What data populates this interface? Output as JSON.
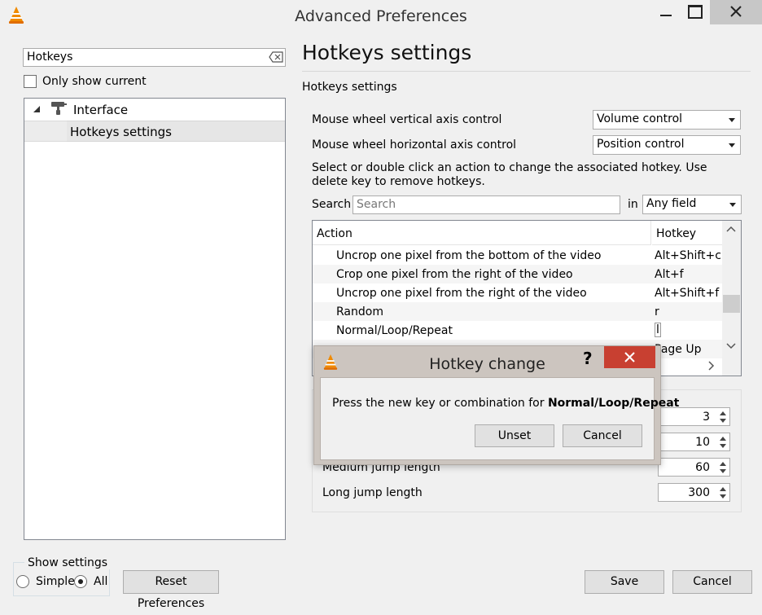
{
  "window": {
    "title": "Advanced Preferences"
  },
  "left": {
    "search_value": "Hotkeys",
    "only_show_current_label": "Only show current",
    "tree": {
      "parent_label": "Interface",
      "child_label": "Hotkeys settings"
    },
    "show_settings": {
      "label": "Show settings",
      "simple_label": "Simple",
      "all_label": "All",
      "selected": "All"
    },
    "reset_label": "Reset Preferences"
  },
  "right": {
    "page_title": "Hotkeys settings",
    "section_header": "Hotkeys settings",
    "vertical_label": "Mouse wheel vertical axis control",
    "vertical_value": "Volume control",
    "horizontal_label": "Mouse wheel horizontal axis control",
    "horizontal_value": "Position control",
    "info_text": "Select or double click an action to change the associated hotkey. Use delete key to remove hotkeys.",
    "search_label": "Search",
    "search_placeholder": "Search",
    "in_label": "in",
    "field_value": "Any field",
    "table": {
      "headers": [
        "Action",
        "Hotkey"
      ],
      "rows": [
        {
          "action": "Uncrop one pixel from the bottom of the video",
          "hotkey": "Alt+Shift+c"
        },
        {
          "action": "Crop one pixel from the right of the video",
          "hotkey": "Alt+f"
        },
        {
          "action": "Uncrop one pixel from the right of the video",
          "hotkey": "Alt+Shift+f"
        },
        {
          "action": "Random",
          "hotkey": "r"
        },
        {
          "action": "Normal/Loop/Repeat",
          "hotkey": "l"
        },
        {
          "action": "",
          "hotkey": "Page Up"
        }
      ]
    },
    "jump": {
      "spin_values": [
        "3",
        "10",
        "60",
        "300"
      ],
      "medium_label": "Medium jump length",
      "long_label": "Long jump length"
    },
    "save_label": "Save",
    "cancel_label": "Cancel"
  },
  "dialog": {
    "title": "Hotkey change",
    "help": "?",
    "message_prefix": "Press the new key or combination for ",
    "message_action": "Normal/Loop/Repeat",
    "unset_label": "Unset",
    "cancel_label": "Cancel"
  },
  "colors": {
    "cone_orange": "#f08a00",
    "close_red": "#c84031"
  }
}
